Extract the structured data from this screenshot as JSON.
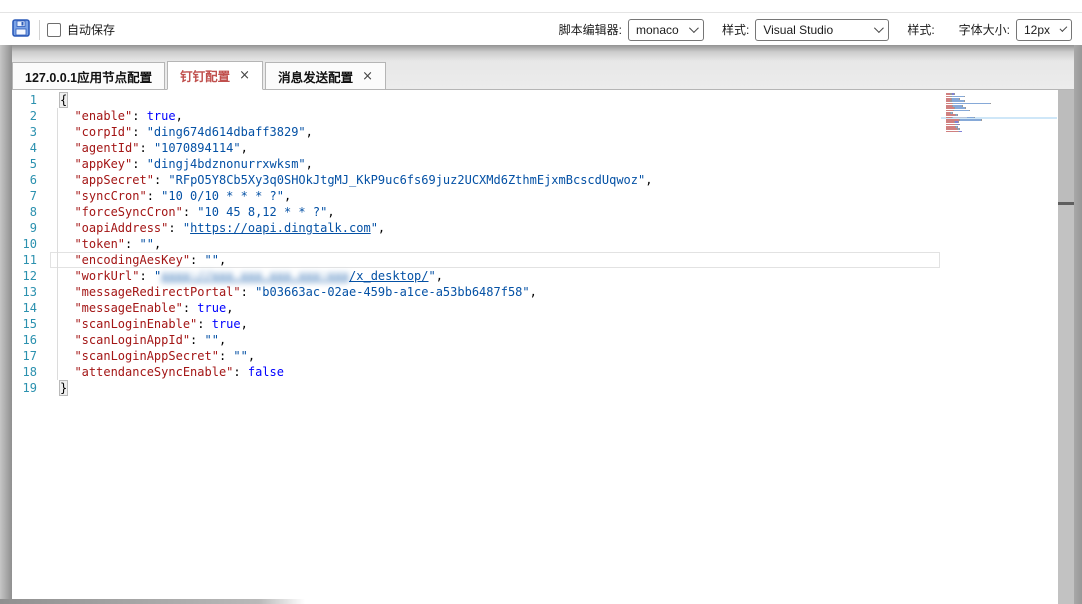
{
  "toolbar": {
    "save_button": "save",
    "autosave_label": "自动保存",
    "script_editor_label": "脚本编辑器:",
    "script_editor_value": "monaco",
    "style_label": "样式:",
    "style_value": "Visual Studio",
    "style2_label": "样式:",
    "font_size_label": "字体大小:",
    "font_size_value": "12px"
  },
  "tabs": [
    {
      "label": "127.0.0.1应用节点配置",
      "closable": false,
      "active": false
    },
    {
      "label": "钉钉配置",
      "closable": true,
      "active": true
    },
    {
      "label": "消息发送配置",
      "closable": true,
      "active": false
    }
  ],
  "tab_close_glyph": "×",
  "colors": {
    "c-key": "#a31515",
    "c-str": "#0451a5",
    "c-bool": "#0000ff",
    "c-linenum": "#2b91af",
    "c-activetab": "#c0504d"
  },
  "editor": {
    "language": "json",
    "line_count": 19,
    "current_line": 11,
    "minimap_highlight_line": 12,
    "redacted_note": "workUrl host portion is blurred/censored in screenshot",
    "lines": [
      [
        [
          "hb",
          "{"
        ]
      ],
      [
        [
          "p",
          "  "
        ],
        [
          "k",
          "\"enable\""
        ],
        [
          "p",
          ": "
        ],
        [
          "b",
          "true"
        ],
        [
          "p",
          ","
        ]
      ],
      [
        [
          "p",
          "  "
        ],
        [
          "k",
          "\"corpId\""
        ],
        [
          "p",
          ": "
        ],
        [
          "s",
          "\"ding674d614dbaff3829\""
        ],
        [
          "p",
          ","
        ]
      ],
      [
        [
          "p",
          "  "
        ],
        [
          "k",
          "\"agentId\""
        ],
        [
          "p",
          ": "
        ],
        [
          "s",
          "\"1070894114\""
        ],
        [
          "p",
          ","
        ]
      ],
      [
        [
          "p",
          "  "
        ],
        [
          "k",
          "\"appKey\""
        ],
        [
          "p",
          ": "
        ],
        [
          "s",
          "\"dingj4bdznonurrxwksm\""
        ],
        [
          "p",
          ","
        ]
      ],
      [
        [
          "p",
          "  "
        ],
        [
          "k",
          "\"appSecret\""
        ],
        [
          "p",
          ": "
        ],
        [
          "s",
          "\"RFpO5Y8Cb5Xy3q0SHOkJtgMJ_KkP9uc6fs69juz2UCXMd6ZthmEjxmBcscdUqwoz\""
        ],
        [
          "p",
          ","
        ]
      ],
      [
        [
          "p",
          "  "
        ],
        [
          "k",
          "\"syncCron\""
        ],
        [
          "p",
          ": "
        ],
        [
          "s",
          "\"10 0/10 * * * ?\""
        ],
        [
          "p",
          ","
        ]
      ],
      [
        [
          "p",
          "  "
        ],
        [
          "k",
          "\"forceSyncCron\""
        ],
        [
          "p",
          ": "
        ],
        [
          "s",
          "\"10 45 8,12 * * ?\""
        ],
        [
          "p",
          ","
        ]
      ],
      [
        [
          "p",
          "  "
        ],
        [
          "k",
          "\"oapiAddress\""
        ],
        [
          "p",
          ": "
        ],
        [
          "s",
          "\""
        ],
        [
          "l",
          "https://oapi.dingtalk.com"
        ],
        [
          "s",
          "\""
        ],
        [
          "p",
          ","
        ]
      ],
      [
        [
          "p",
          "  "
        ],
        [
          "k",
          "\"token\""
        ],
        [
          "p",
          ": "
        ],
        [
          "s",
          "\"\""
        ],
        [
          "p",
          ","
        ]
      ],
      [
        [
          "p",
          "  "
        ],
        [
          "k",
          "\"encodingAesKey\""
        ],
        [
          "p",
          ": "
        ],
        [
          "s",
          "\"\""
        ],
        [
          "p",
          ","
        ]
      ],
      [
        [
          "p",
          "  "
        ],
        [
          "k",
          "\"workUrl\""
        ],
        [
          "p",
          ": "
        ],
        [
          "s",
          "\""
        ],
        [
          "r",
          "xxxx://xxx.xxx.xxx.xxx:xxx"
        ],
        [
          "l",
          "/x_desktop/"
        ],
        [
          "s",
          "\""
        ],
        [
          "p",
          ","
        ]
      ],
      [
        [
          "p",
          "  "
        ],
        [
          "k",
          "\"messageRedirectPortal\""
        ],
        [
          "p",
          ": "
        ],
        [
          "s",
          "\"b03663ac-02ae-459b-a1ce-a53bb6487f58\""
        ],
        [
          "p",
          ","
        ]
      ],
      [
        [
          "p",
          "  "
        ],
        [
          "k",
          "\"messageEnable\""
        ],
        [
          "p",
          ": "
        ],
        [
          "b",
          "true"
        ],
        [
          "p",
          ","
        ]
      ],
      [
        [
          "p",
          "  "
        ],
        [
          "k",
          "\"scanLoginEnable\""
        ],
        [
          "p",
          ": "
        ],
        [
          "b",
          "true"
        ],
        [
          "p",
          ","
        ]
      ],
      [
        [
          "p",
          "  "
        ],
        [
          "k",
          "\"scanLoginAppId\""
        ],
        [
          "p",
          ": "
        ],
        [
          "s",
          "\"\""
        ],
        [
          "p",
          ","
        ]
      ],
      [
        [
          "p",
          "  "
        ],
        [
          "k",
          "\"scanLoginAppSecret\""
        ],
        [
          "p",
          ": "
        ],
        [
          "s",
          "\"\""
        ],
        [
          "p",
          ","
        ]
      ],
      [
        [
          "p",
          "  "
        ],
        [
          "k",
          "\"attendanceSyncEnable\""
        ],
        [
          "p",
          ": "
        ],
        [
          "b",
          "false"
        ]
      ],
      [
        [
          "hb",
          "}"
        ]
      ]
    ]
  }
}
